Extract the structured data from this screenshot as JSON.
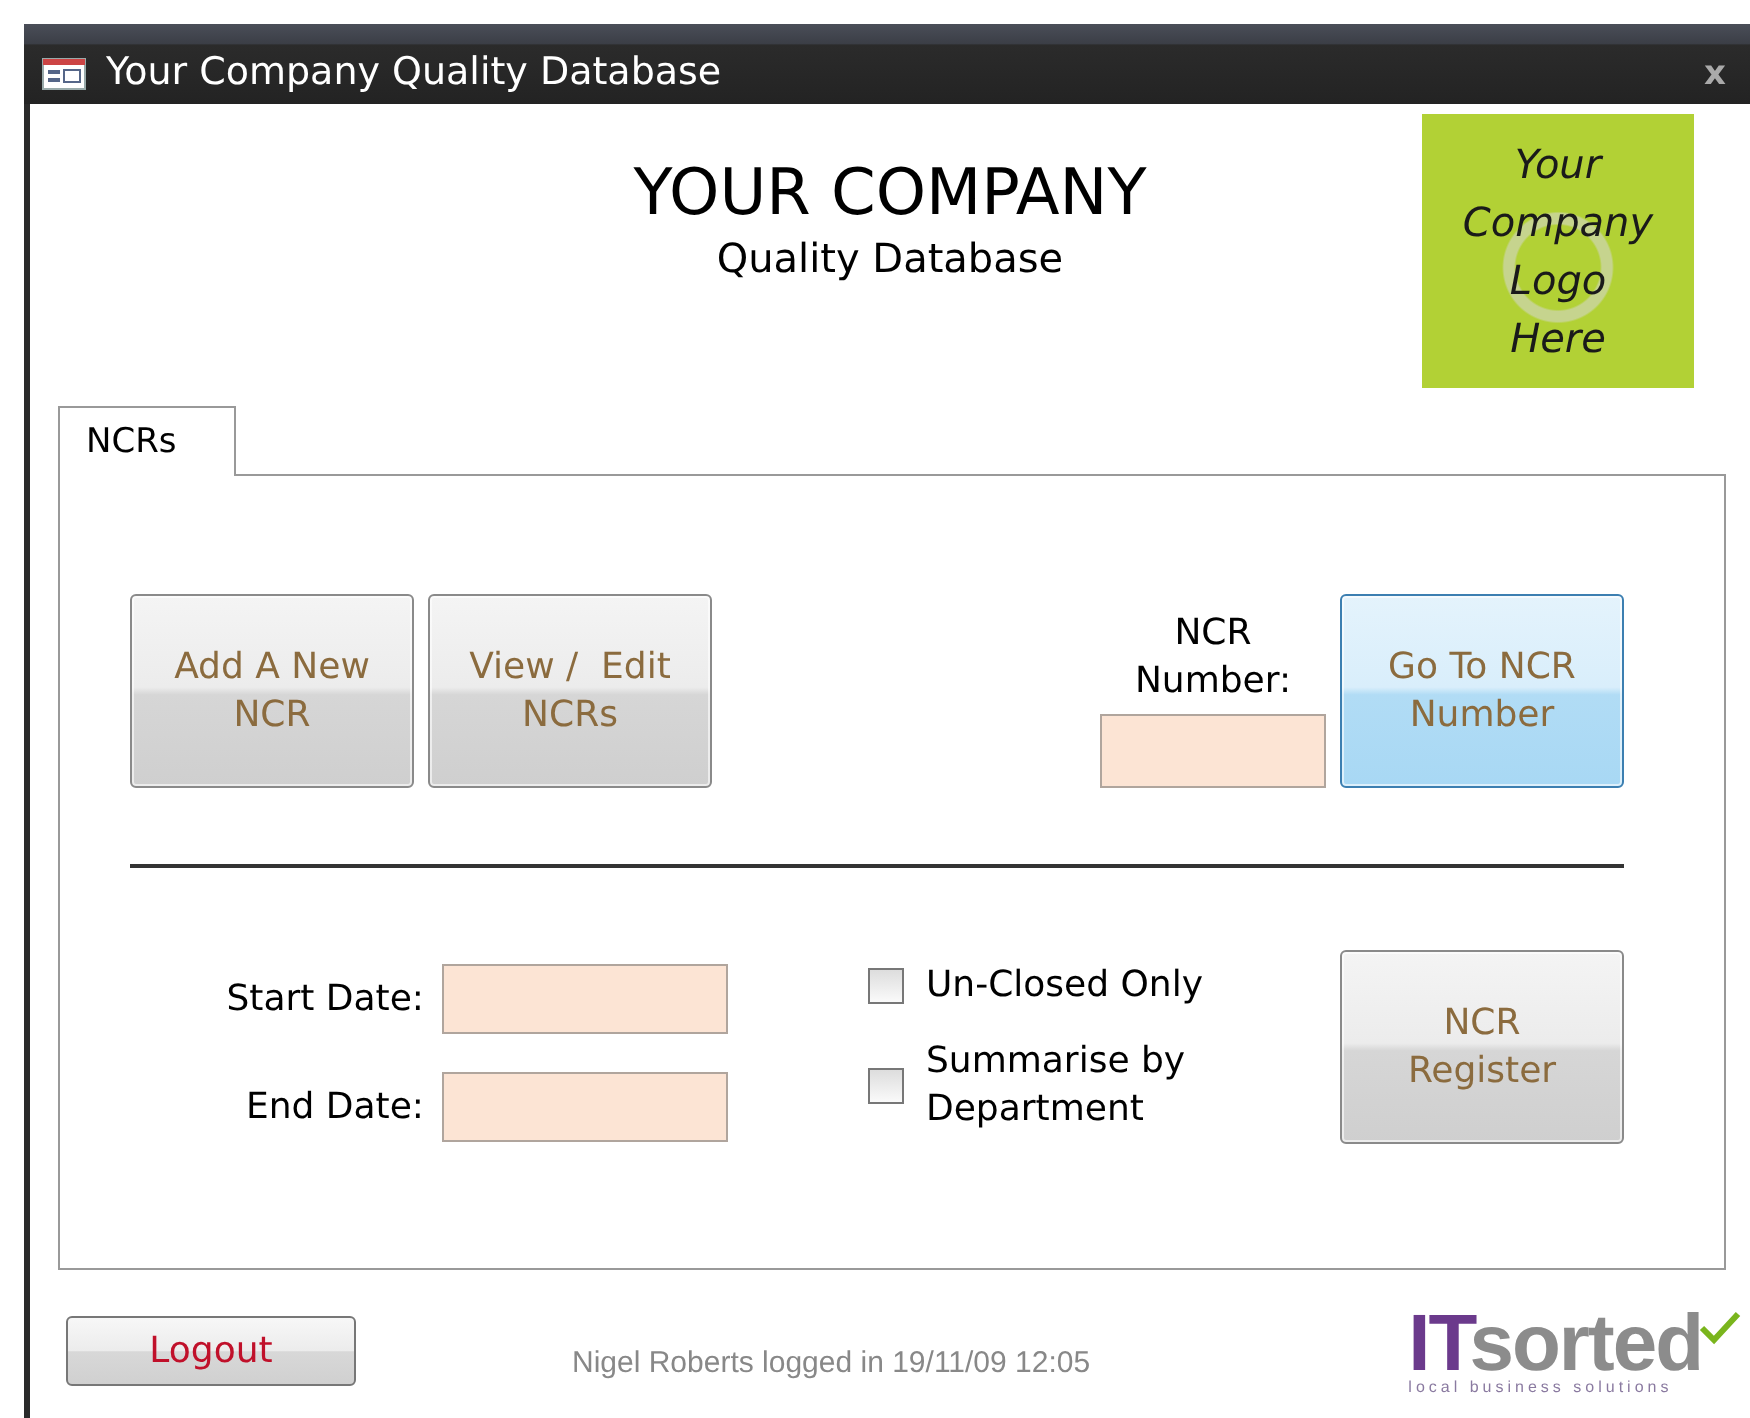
{
  "window": {
    "title": "Your Company Quality Database",
    "close": "x"
  },
  "header": {
    "company": "YOUR COMPANY",
    "subtitle": "Quality Database",
    "logo_text": "Your\nCompany\nLogo\nHere"
  },
  "tabs": [
    {
      "label": "NCRs",
      "selected": true
    }
  ],
  "actions": [
    {
      "label": "Add A New NCR",
      "kind": "plain"
    },
    {
      "label": "View /  Edit NCRs",
      "kind": "plain"
    }
  ],
  "ncr_lookup": {
    "label": "NCR Number:",
    "button": {
      "label": "Go To NCR Number",
      "kind": "primary"
    }
  },
  "report": {
    "fields": [
      {
        "label": "Start Date:"
      },
      {
        "label": "End Date:"
      }
    ],
    "options": [
      {
        "label": "Un-Closed Only",
        "checked": false
      },
      {
        "label": "Summarise by Department",
        "checked": false
      }
    ],
    "button": {
      "label": "NCR Register",
      "kind": "plain"
    }
  },
  "footer": {
    "logout": "Logout",
    "status": "Nigel Roberts logged in 19/11/09 12:05",
    "brand": {
      "part1": "IT",
      "part2": "sorted",
      "tagline": "local business solutions"
    }
  }
}
